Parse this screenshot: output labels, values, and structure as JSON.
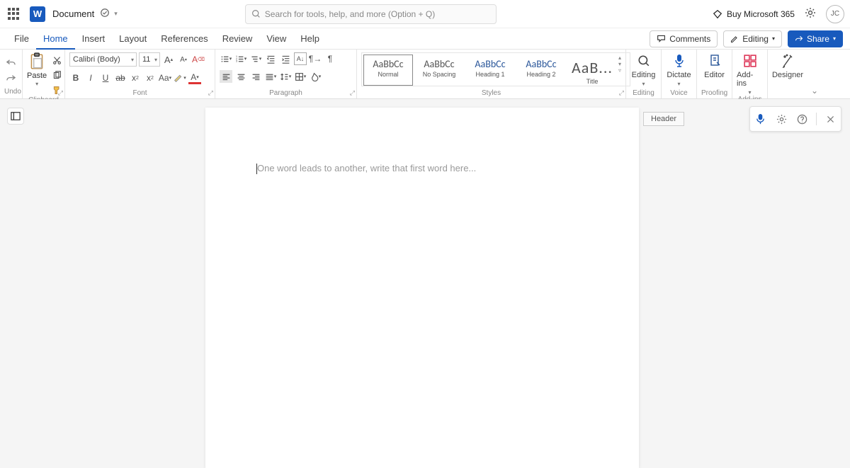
{
  "title": {
    "doc_name": "Document",
    "search_placeholder": "Search for tools, help, and more (Option + Q)",
    "buy": "Buy Microsoft 365",
    "avatar": "JC"
  },
  "tabs": {
    "file": "File",
    "home": "Home",
    "insert": "Insert",
    "layout": "Layout",
    "references": "References",
    "review": "Review",
    "view": "View",
    "help": "Help",
    "comments": "Comments",
    "editing": "Editing",
    "share": "Share"
  },
  "ribbon": {
    "undo": "Undo",
    "clipboard": {
      "label": "Clipboard",
      "paste": "Paste"
    },
    "font": {
      "label": "Font",
      "name": "Calibri (Body)",
      "size": "11"
    },
    "paragraph": {
      "label": "Paragraph"
    },
    "styles": {
      "label": "Styles",
      "items": [
        {
          "preview": "AaBbCc",
          "name": "Normal"
        },
        {
          "preview": "AaBbCc",
          "name": "No Spacing"
        },
        {
          "preview": "AaBbCc",
          "name": "Heading 1"
        },
        {
          "preview": "AaBbCc",
          "name": "Heading 2"
        },
        {
          "preview": "AaB...",
          "name": "Title"
        }
      ]
    },
    "right": {
      "editing": "Editing",
      "dictate": "Dictate",
      "editor": "Editor",
      "addins": "Add-ins",
      "designer": "Designer",
      "voice": "Voice",
      "proofing": "Proofing",
      "addins2": "Add-ins",
      "editing2": "Editing"
    }
  },
  "doc": {
    "placeholder": "One word leads to another, write that first word here...",
    "header": "Header"
  }
}
